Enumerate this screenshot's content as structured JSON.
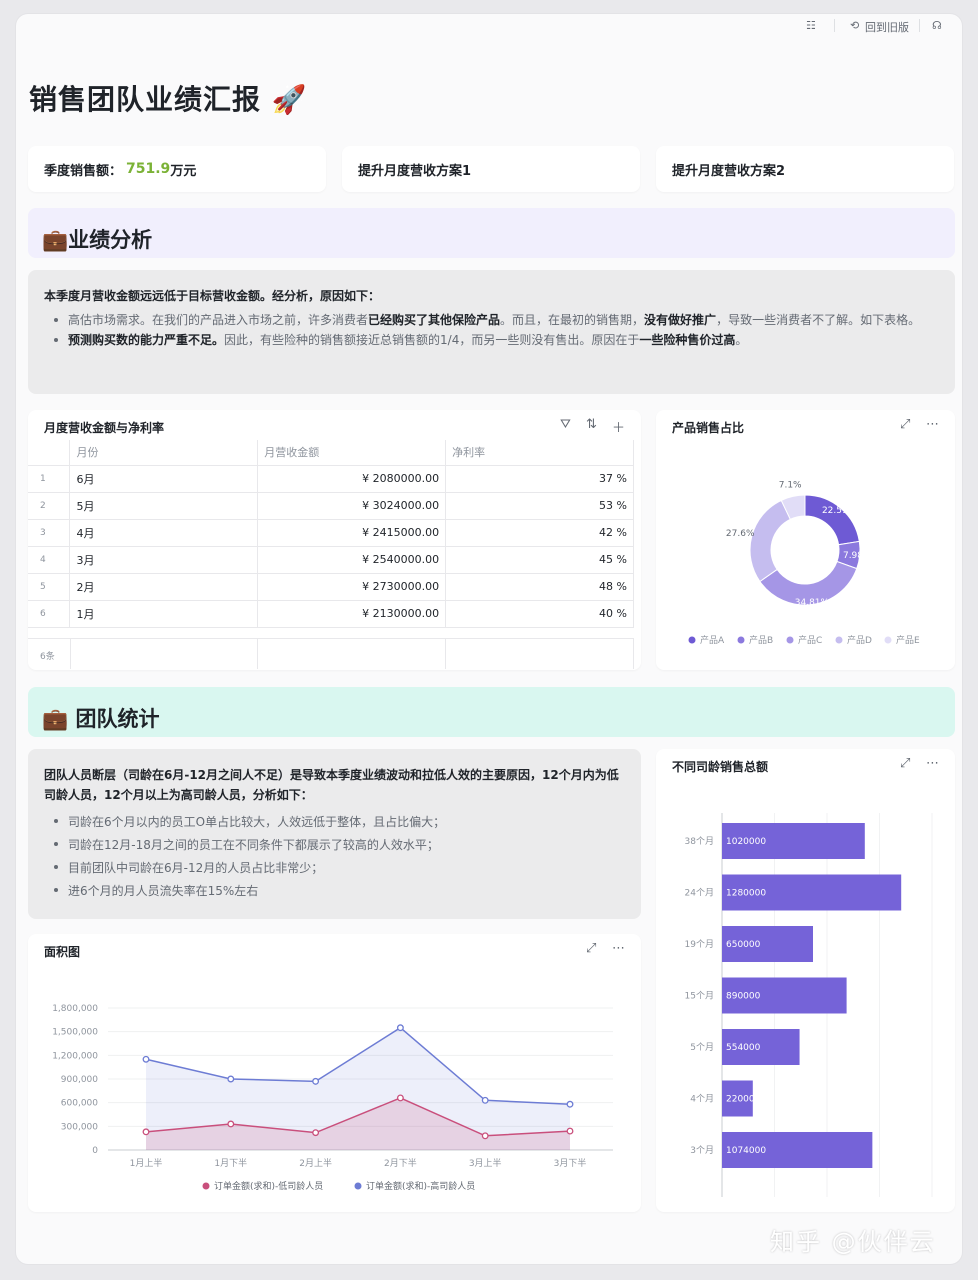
{
  "topbar": {
    "settings_icon": "sliders-icon",
    "revert_icon": "clock-icon",
    "revert_label": "回到旧版",
    "support_icon": "headset-icon"
  },
  "title": "销售团队业绩汇报 🚀",
  "kpis": {
    "sales_label": "季度销售额：",
    "sales_value": "751.9",
    "sales_unit": "万元",
    "plan1": "提升月度营收方案1",
    "plan2": "提升月度营收方案2"
  },
  "section1": {
    "title": "💼业绩分析",
    "bg": "#f1effd"
  },
  "analysis": {
    "intro": "本季度月营收金额远远低于目标营收金额。经分析，原因如下：",
    "b1_a": "高估市场需求。在我们的产品进入市场之前，许多消费者",
    "b1_b": "已经购买了其他保险产品",
    "b1_c": "。而且，在最初的销售期，",
    "b1_d": "没有做好推广",
    "b1_e": "，导致一些消费者不了解。如下表格。",
    "b2_a": "预测购买数的能力严重不足。",
    "b2_b": "因此，有些险种的销售额接近总销售额的1/4，而另一些则没有售出。原因在于",
    "b2_c": "一些险种售价过高",
    "b2_d": "。"
  },
  "revenue_table": {
    "title": "月度营收金额与净利率",
    "headers": [
      "月份",
      "月营收金额",
      "净利率"
    ],
    "rows": [
      {
        "idx": "1",
        "month": "6月",
        "revenue": "¥ 2080000.00",
        "rate": "37 %"
      },
      {
        "idx": "2",
        "month": "5月",
        "revenue": "¥ 3024000.00",
        "rate": "53 %"
      },
      {
        "idx": "3",
        "month": "4月",
        "revenue": "¥ 2415000.00",
        "rate": "42 %"
      },
      {
        "idx": "4",
        "month": "3月",
        "revenue": "¥ 2540000.00",
        "rate": "45 %"
      },
      {
        "idx": "5",
        "month": "2月",
        "revenue": "¥ 2730000.00",
        "rate": "48 %"
      },
      {
        "idx": "6",
        "month": "1月",
        "revenue": "¥ 2130000.00",
        "rate": "40 %"
      }
    ],
    "footer": "6条"
  },
  "section2": {
    "title": "💼 团队统计",
    "bg": "#d9f7f0"
  },
  "team": {
    "intro": "团队人员断层（司龄在6月-12月之间人不足）是导致本季度业绩波动和拉低人效的主要原因，12个月内为低司龄人员，12个月以上为高司龄人员，分析如下：",
    "bullets": [
      "司龄在6个月以内的员工O单占比较大，人效远低于整体，且占比偏大；",
      "司龄在12月-18月之间的员工在不同条件下都展示了较高的人效水平；",
      "目前团队中司龄在6月-12月的人员占比非常少；",
      "进6个月的月人员流失率在15%左右"
    ]
  },
  "chart_data": [
    {
      "type": "pie",
      "title": "产品销售占比",
      "categories": [
        "产品A",
        "产品B",
        "产品C",
        "产品D",
        "产品E"
      ],
      "values": [
        22.51,
        7.98,
        34.81,
        27.6,
        7.1
      ],
      "labels": [
        "22.51%",
        "7.98%",
        "34.81%",
        "27.6%",
        "7.1%"
      ],
      "colors": [
        "#6e5ad4",
        "#8b79de",
        "#a596e6",
        "#c5bdef",
        "#e1ddf7"
      ],
      "legend": "bottom"
    },
    {
      "type": "area",
      "title": "面积图",
      "categories": [
        "1月上半",
        "1月下半",
        "2月上半",
        "2月下半",
        "3月上半",
        "3月下半"
      ],
      "series": [
        {
          "name": "订单金额(求和)-低司龄人员",
          "values": [
            230000,
            330000,
            220000,
            660000,
            180000,
            240000
          ],
          "color": "#c94f7c"
        },
        {
          "name": "订单金额(求和)-高司龄人员",
          "values": [
            1150000,
            900000,
            870000,
            1550000,
            630000,
            580000
          ],
          "color": "#6d7cd4"
        }
      ],
      "ylim": [
        0,
        1800000
      ],
      "yticks": [
        "0",
        "300,000",
        "600,000",
        "900,000",
        "1,200,000",
        "1,500,000",
        "1,800,000"
      ],
      "legend": "bottom"
    },
    {
      "type": "bar",
      "orientation": "horizontal",
      "title": "不同司龄销售总额",
      "categories": [
        "38个月",
        "24个月",
        "19个月",
        "15个月",
        "5个月",
        "4个月",
        "3个月"
      ],
      "values": [
        1020000,
        1280000,
        650000,
        890000,
        554000,
        220000,
        1074000
      ],
      "labels": [
        "1020000",
        "1280000",
        "650000",
        "890000",
        "554000",
        "220000",
        "1074000"
      ],
      "color": "#7563d8",
      "xlim": [
        0,
        1500000
      ]
    }
  ],
  "widgets": {
    "pie_title": "产品销售占比",
    "area_title": "面积图",
    "bar_title": "不同司龄销售总额",
    "tool_filter": "filter-icon",
    "tool_sort": "sort-icon",
    "tool_add": "plus-icon",
    "tool_expand": "expand-icon",
    "tool_more": "more-icon"
  },
  "watermark": "知乎 @伙伴云"
}
